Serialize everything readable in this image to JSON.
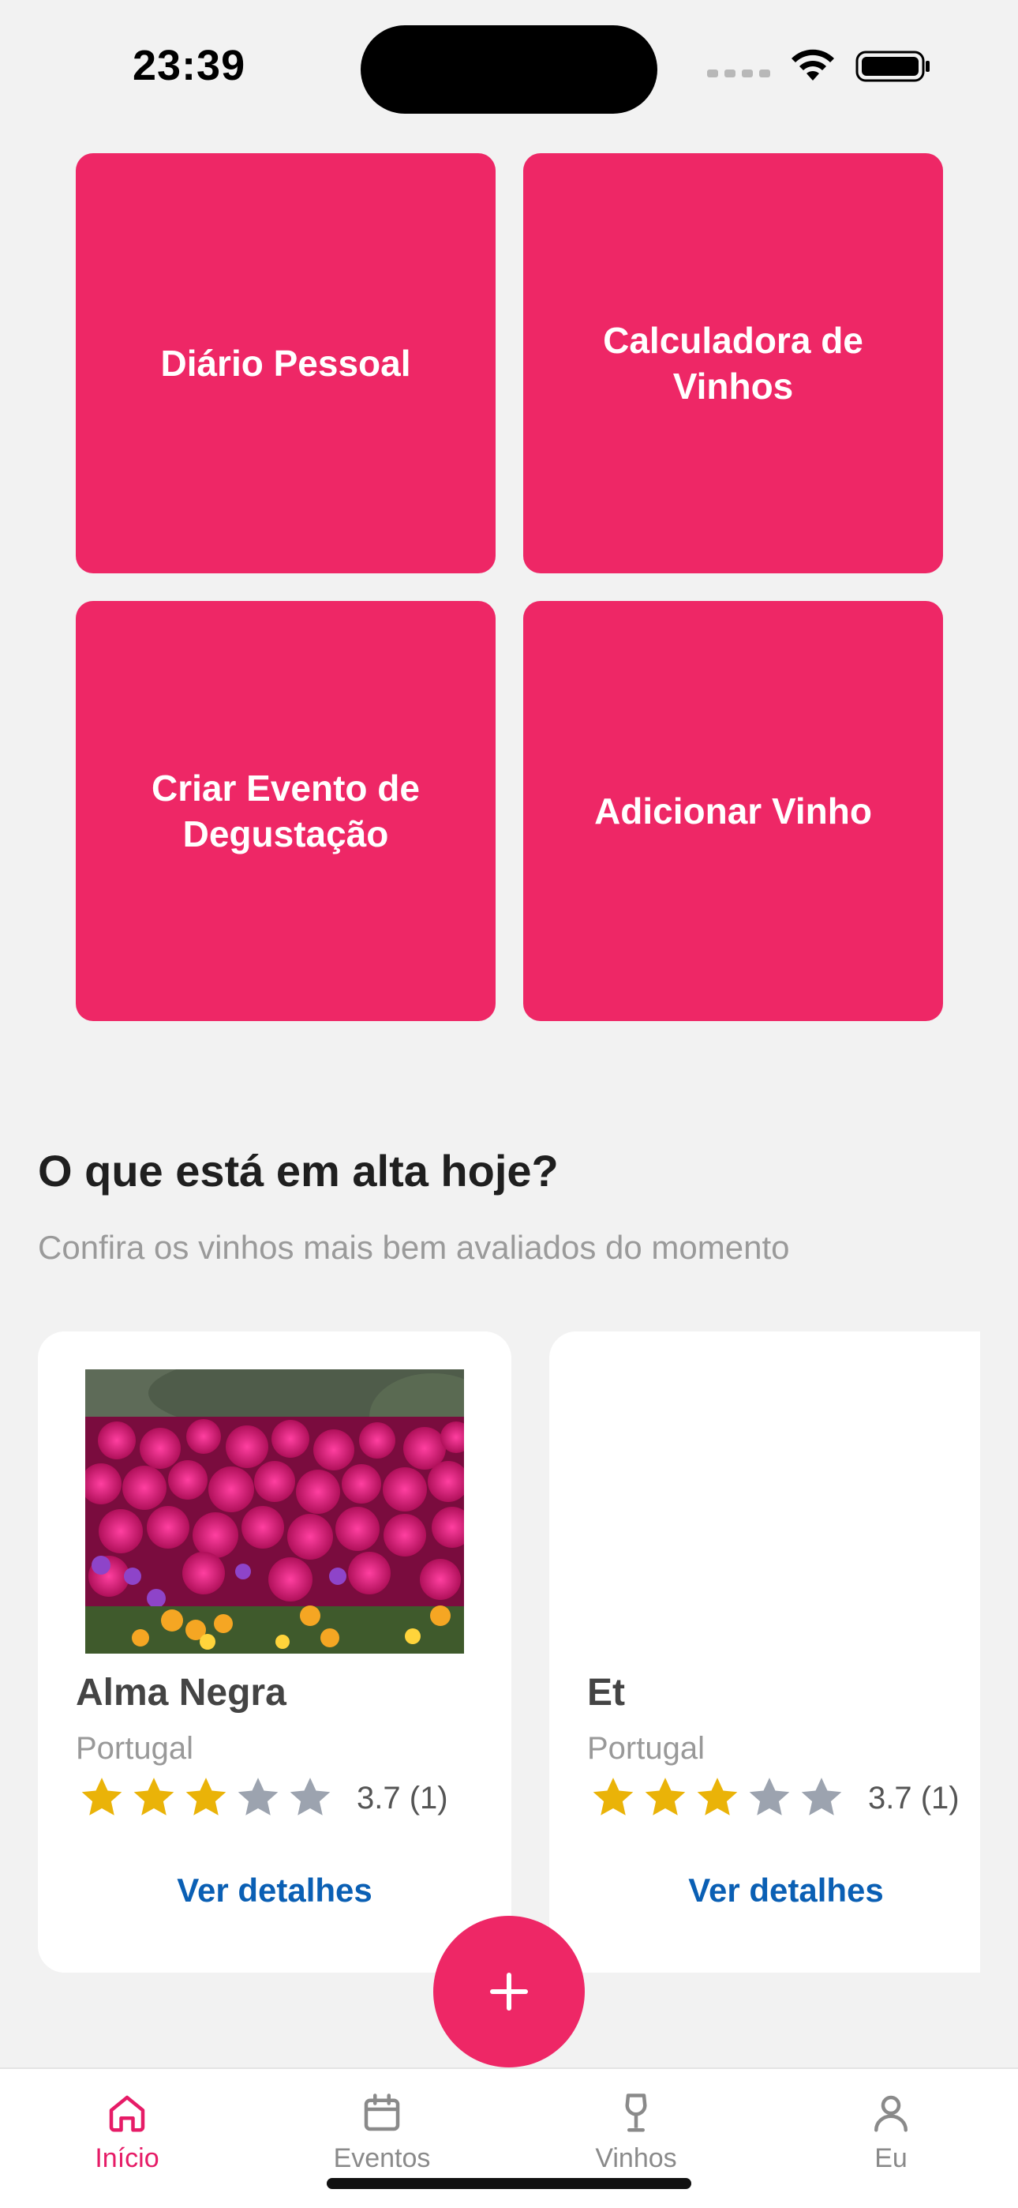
{
  "status": {
    "time": "23:39"
  },
  "tiles": [
    {
      "label": "Diário Pessoal"
    },
    {
      "label": "Calculadora de Vinhos"
    },
    {
      "label": "Criar Evento de Degustação"
    },
    {
      "label": "Adicionar Vinho"
    }
  ],
  "trending": {
    "title": "O que está em alta hoje?",
    "subtitle": "Confira os vinhos mais bem avaliados do momento"
  },
  "wines": [
    {
      "name": "Alma Negra",
      "country": "Portugal",
      "rating_text": "3.7 (1)",
      "rating": 3,
      "details_label": "Ver detalhes"
    },
    {
      "name": "Et",
      "country": "Portugal",
      "rating_text": "3.7 (1)",
      "rating": 3,
      "details_label": "Ver detalhes"
    }
  ],
  "fab": {
    "icon": "plus-icon"
  },
  "tabbar": {
    "items": [
      {
        "label": "Início",
        "icon": "home-icon",
        "active": true
      },
      {
        "label": "Eventos",
        "icon": "calendar-icon",
        "active": false
      },
      {
        "label": "Vinhos",
        "icon": "wine-glass-icon",
        "active": false
      },
      {
        "label": "Eu",
        "icon": "person-icon",
        "active": false
      }
    ]
  },
  "colors": {
    "accent": "#ee2766",
    "link": "#0a5fb4",
    "star_filled": "#eab308",
    "star_empty": "#9ca3af",
    "background": "#f2f2f2"
  }
}
